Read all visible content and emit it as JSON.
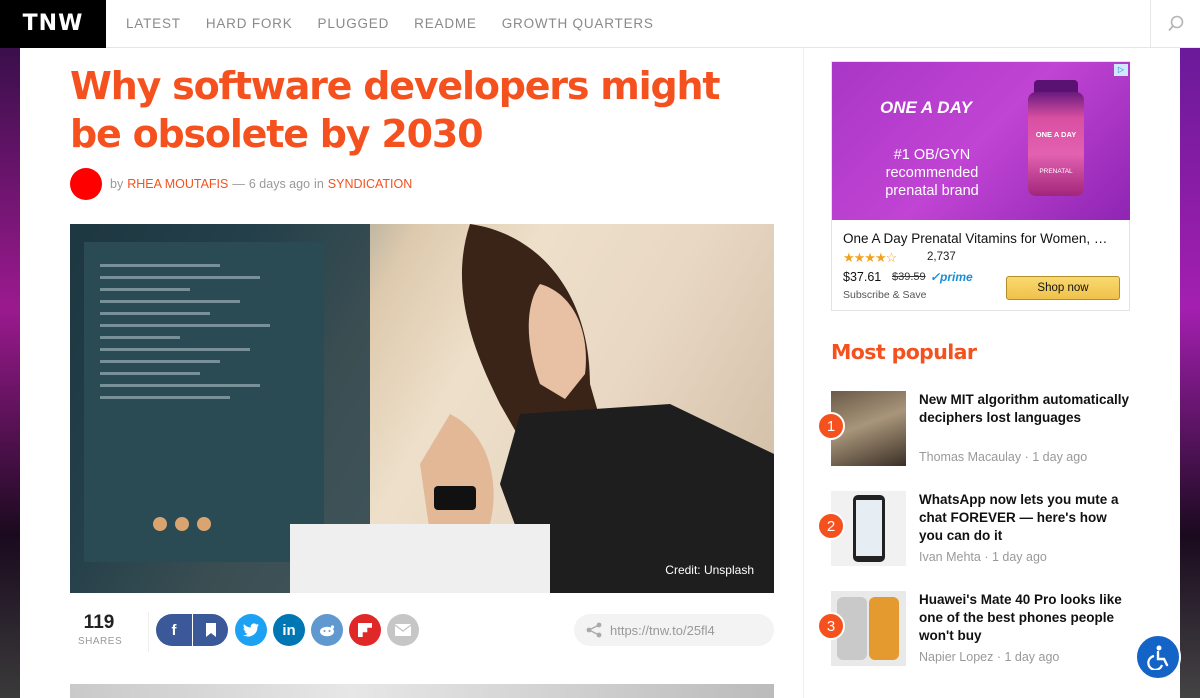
{
  "header": {
    "logo": "TNW",
    "nav": [
      "LATEST",
      "HARD FORK",
      "PLUGGED",
      "README",
      "GROWTH QUARTERS"
    ]
  },
  "article": {
    "title": "Why software developers might be obsolete by 2030",
    "byline_prefix": "by",
    "author": "RHEA MOUTAFIS",
    "separator": "—",
    "time": "6 days ago",
    "in_label": "in",
    "category": "SYNDICATION",
    "image_credit": "Credit: Unsplash",
    "shares_count": "119",
    "shares_label": "SHARES",
    "short_url": "https://tnw.to/25fl4"
  },
  "ad": {
    "brand": "ONE A DAY",
    "tagline": "#1 OB/GYN recommended prenatal brand",
    "bottle_label": "ONE A DAY",
    "bottle_sub": "PRENATAL",
    "product": "One A Day Prenatal Vitamins for Women, …",
    "stars": "★★★★☆",
    "rating_count": "2,737",
    "price": "$37.61",
    "old_price": "$39.59",
    "prime": "✓prime",
    "subscribe": "Subscribe & Save",
    "shop_button": "Shop now"
  },
  "popular": {
    "title": "Most popular",
    "items": [
      {
        "rank": "1",
        "title": "New MIT algorithm automatically deciphers lost languages",
        "author": "Thomas Macaulay",
        "time": "1 day ago"
      },
      {
        "rank": "2",
        "title": "WhatsApp now lets you mute a chat FOREVER — here's how you can do it",
        "author": "Ivan Mehta",
        "time": "1 day ago"
      },
      {
        "rank": "3",
        "title": "Huawei's Mate 40 Pro looks like one of the best phones people won't buy",
        "author": "Napier Lopez",
        "time": "1 day ago"
      }
    ]
  },
  "colors": {
    "accent": "#f4511e",
    "facebook": "#3b5998",
    "twitter": "#1da1f2",
    "linkedin": "#0077b5",
    "reddit": "#5f99cf",
    "flipboard": "#e12828",
    "email": "#c6c6c6",
    "accessibility": "#1463c6"
  }
}
